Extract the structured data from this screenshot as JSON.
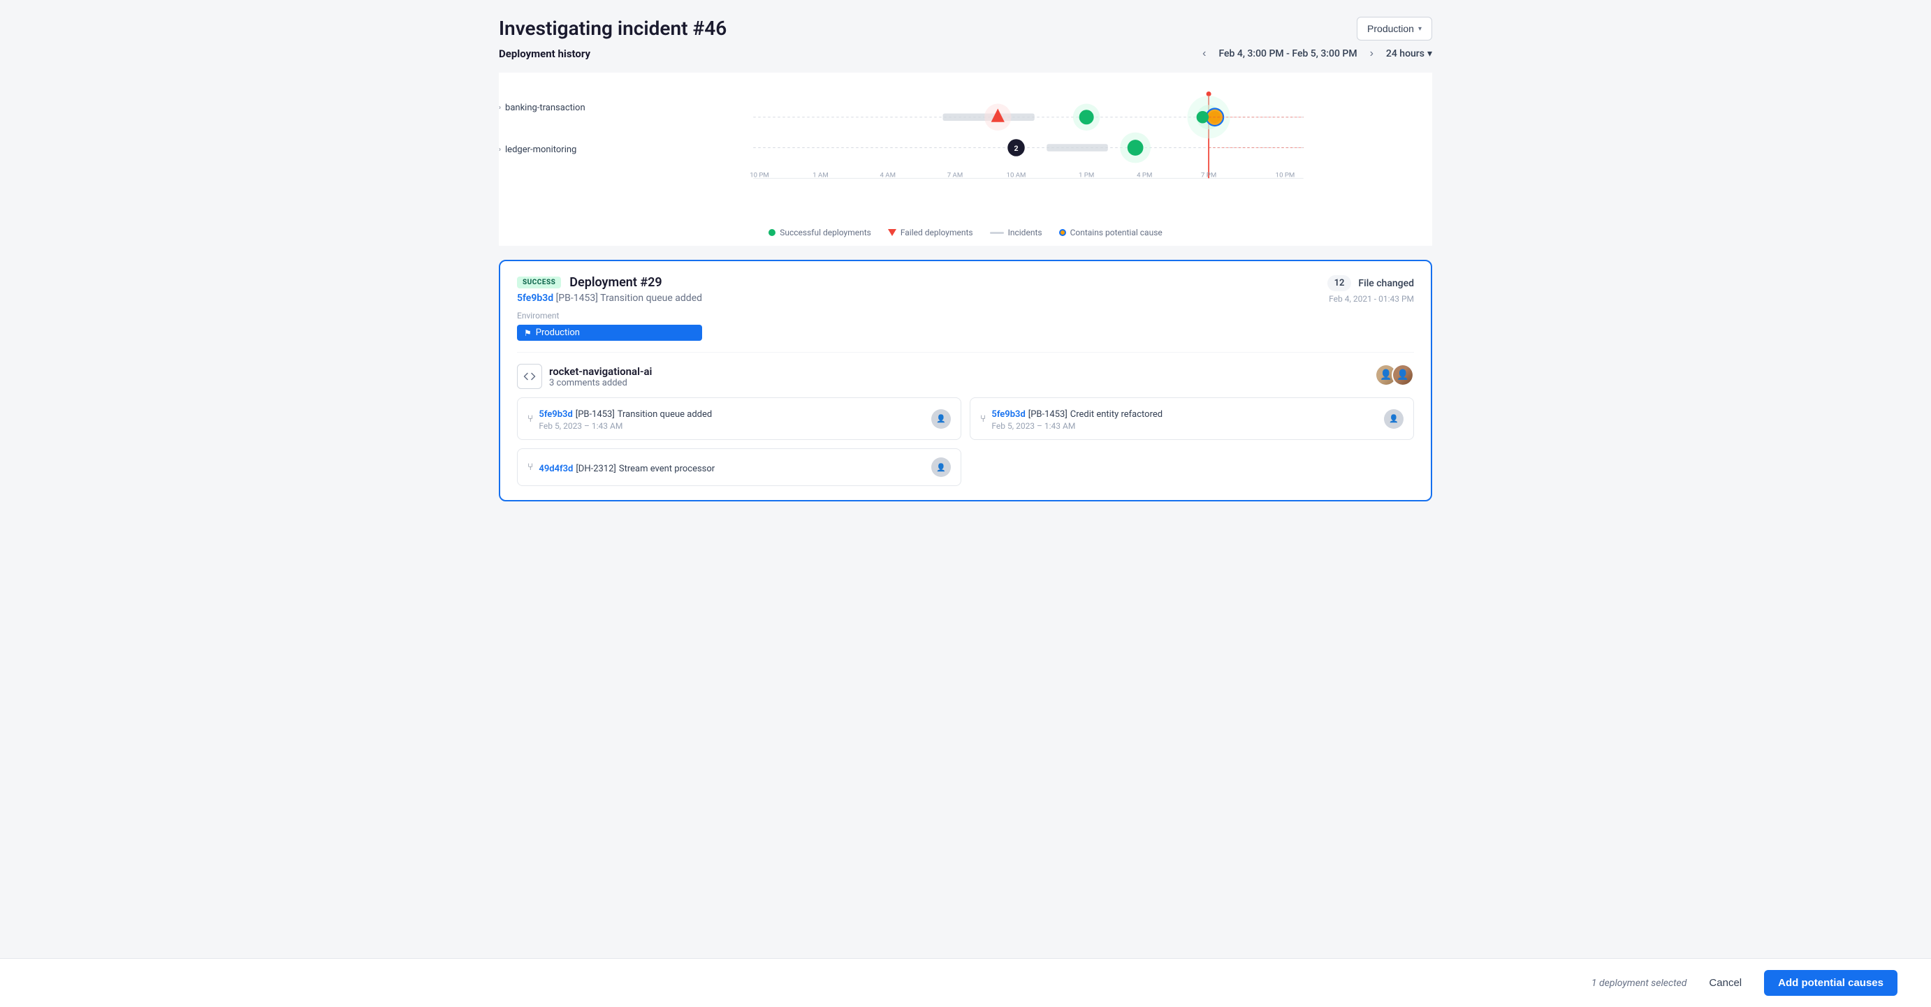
{
  "page": {
    "title": "Investigating incident #46",
    "env_dropdown": {
      "label": "Production",
      "chevron": "▾"
    },
    "deployment_history": {
      "label": "Deployment history",
      "time_range": "Feb 4, 3:00 PM - Feb 5, 3:00 PM",
      "hours_label": "24 hours",
      "hours_chevron": "▾"
    },
    "chart": {
      "x_labels": [
        "10 PM",
        "1 AM",
        "4 AM",
        "7 AM",
        "10 AM",
        "1 PM",
        "4 PM",
        "7 PM",
        "10 PM"
      ],
      "rows": [
        {
          "label": "banking-transaction"
        },
        {
          "label": "ledger-monitoring"
        }
      ],
      "legend": [
        {
          "type": "dot",
          "color": "#12b76a",
          "label": "Successful deployments"
        },
        {
          "type": "triangle",
          "color": "#f04438",
          "label": "Failed deployments"
        },
        {
          "type": "line",
          "color": "#d0d5dd",
          "label": "Incidents"
        },
        {
          "type": "dot-outlined",
          "color": "#f59e0b",
          "label": "Contains potential cause"
        }
      ]
    },
    "deployment_card": {
      "status": "SUCCESS",
      "name": "Deployment #29",
      "commit": "5fe9b3d [PB-1453] Transition queue added",
      "commit_hash": "5fe9b3d",
      "commit_rest": " [PB-1453] Transition queue added",
      "env_label": "Enviroment",
      "env_tag": "Production",
      "file_count": "12",
      "file_changed_label": "File changed",
      "file_date": "Feb 4, 2021 - 01:43 PM",
      "repo": {
        "name": "rocket-navigational-ai",
        "comments": "3 comments added"
      },
      "commits": [
        {
          "hash": "5fe9b3d",
          "ticket": "[PB-1453]",
          "message": "Transition queue added",
          "date": "Feb 5, 2023 – 1:43 AM"
        },
        {
          "hash": "5fe9b3d",
          "ticket": "[PB-1453]",
          "message": "Credit entity refactored",
          "date": "Feb 5, 2023 – 1:43 AM"
        },
        {
          "hash": "49d4f3d",
          "ticket": "[DH-2312]",
          "message": "Stream event processor",
          "date": ""
        }
      ]
    },
    "bottom_bar": {
      "selected_label": "1 deployment selected",
      "cancel_label": "Cancel",
      "add_causes_label": "Add potential causes"
    }
  }
}
